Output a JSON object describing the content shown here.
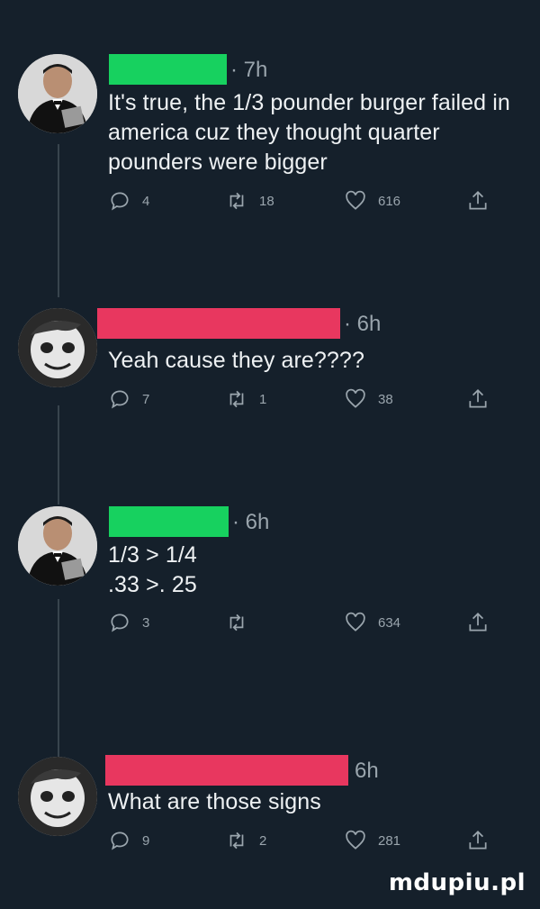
{
  "colors": {
    "background": "#15202b",
    "redact_green": "#17d15f",
    "redact_pink": "#e8375f",
    "muted": "#9aa5ad"
  },
  "tweets": [
    {
      "redaction_color": "green",
      "time": "· 7h",
      "text": "It's true, the 1/3 pounder burger failed in\namerica cuz they thought quarter\npounders were bigger",
      "replies": "4",
      "retweets": "18",
      "likes": "616"
    },
    {
      "redaction_color": "pink",
      "time": "· 6h",
      "text": "Yeah cause they are????",
      "replies": "7",
      "retweets": "1",
      "likes": "38"
    },
    {
      "redaction_color": "green",
      "time": "· 6h",
      "text": "1/3 > 1/4\n.33 >. 25",
      "replies": "3",
      "retweets": "",
      "likes": "634"
    },
    {
      "redaction_color": "pink",
      "time": "6h",
      "text": "What are those signs",
      "replies": "9",
      "retweets": "2",
      "likes": "281"
    }
  ],
  "icons": {
    "reply": "comment-bubble-icon",
    "retweet": "retweet-arrows-icon",
    "like": "heart-icon",
    "share": "share-upload-icon"
  },
  "watermark": "mdupiu.pl"
}
